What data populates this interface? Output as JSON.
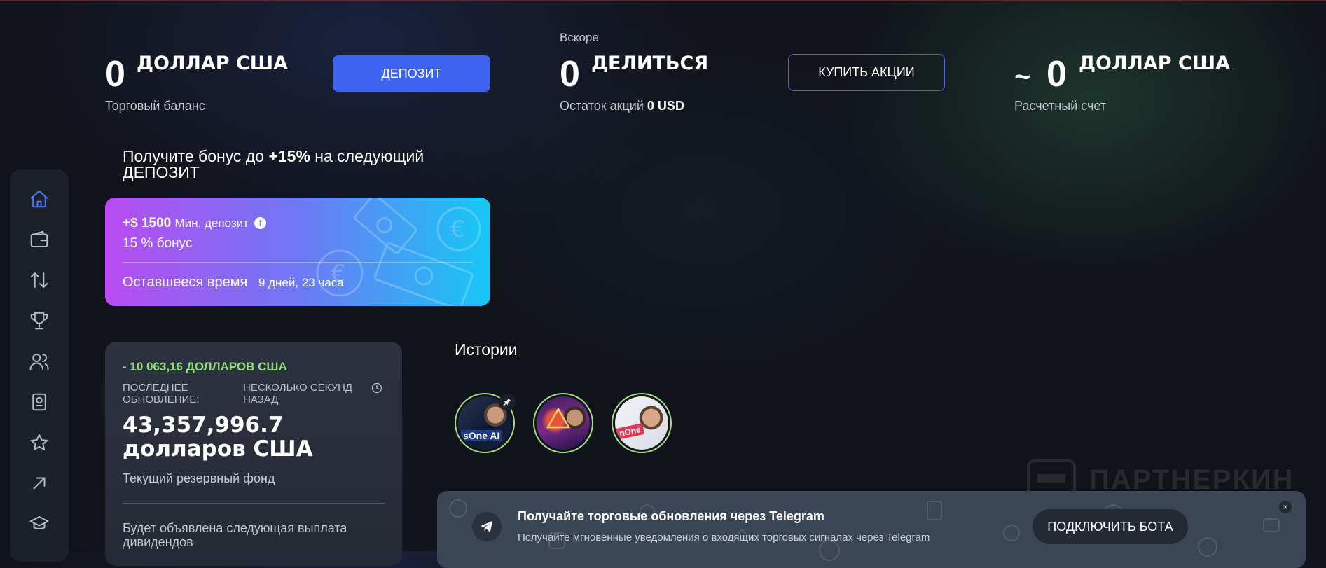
{
  "stats": {
    "trading": {
      "value": "0",
      "unit": "ДОЛЛАР США",
      "label": "Торговый баланс",
      "button": "ДЕПОЗИТ"
    },
    "shares": {
      "soon": "Вскоре",
      "value": "0",
      "unit": "ДЕЛИТЬСЯ",
      "label_prefix": "Остаток акций",
      "label_value": "0 USD",
      "button": "КУПИТЬ АКЦИИ"
    },
    "settlement": {
      "tilde": "~",
      "value": "0",
      "unit": "ДОЛЛАР США",
      "label": "Расчетный счет"
    }
  },
  "bonus": {
    "title_prefix": "Получите бонус до",
    "title_bold": "+15%",
    "title_suffix": "на следующий ДЕПОЗИТ",
    "amount": "+$ 1500",
    "min_label": "Мин. депозит",
    "percent": "15 % бонус",
    "time_label": "Оставшееся время",
    "time_value": "9 дней, 23 часа"
  },
  "reserve": {
    "delta": "- 10 063,16 ДОЛЛАРОВ США",
    "updated_label": "ПОСЛЕДНЕЕ ОБНОВЛЕНИЕ:",
    "updated_value": "НЕСКОЛЬКО СЕКУНД НАЗАД",
    "amount": "43,357,996.7 долларов США",
    "amount_label": "Текущий резервный фонд",
    "next_payout": "Будет объявлена следующая выплата дивидендов"
  },
  "stories": {
    "title": "Истории",
    "items": [
      {
        "caption": "sOne AI",
        "pinned": true
      },
      {
        "caption": "",
        "pinned": false
      },
      {
        "caption": "nOne",
        "pinned": false
      }
    ]
  },
  "telegram": {
    "title": "Получайте торговые обновления через Telegram",
    "subtitle": "Получайте мгновенные уведомления о входящих торговых сигналах через Telegram",
    "button": "ПОДКЛЮЧИТЬ БОТА",
    "close": "×"
  },
  "watermark": {
    "text": "ПАРТНЕРКИН"
  },
  "sidebar": {
    "icons": [
      "home-icon",
      "wallet-icon",
      "transfer-icon",
      "trophy-icon",
      "users-icon",
      "id-badge-icon",
      "star-icon",
      "arrow-up-right-icon",
      "graduation-cap-icon"
    ]
  },
  "colors": {
    "accent": "#3d63f0",
    "positive": "#8fe07a",
    "background": "#101319"
  }
}
